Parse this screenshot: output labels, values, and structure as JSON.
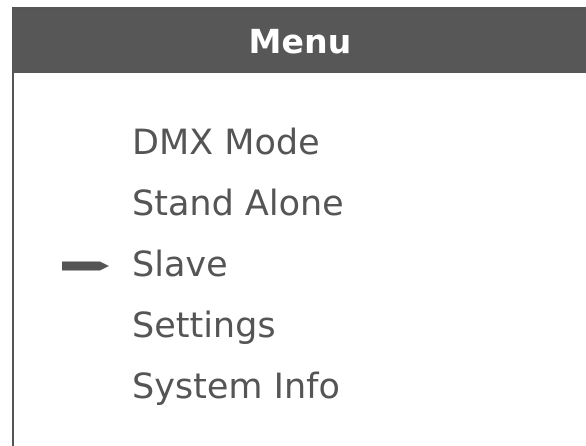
{
  "menu": {
    "title": "Menu",
    "items": [
      {
        "label": "DMX Mode",
        "selected": false
      },
      {
        "label": "Stand Alone",
        "selected": false
      },
      {
        "label": "Slave",
        "selected": true
      },
      {
        "label": "Settings",
        "selected": false
      },
      {
        "label": "System Info",
        "selected": false
      }
    ],
    "pointer_icon": "arrow-right-icon"
  },
  "colors": {
    "header_background": "#575757",
    "header_text": "#ffffff",
    "item_text": "#555555",
    "pointer": "#555555"
  }
}
